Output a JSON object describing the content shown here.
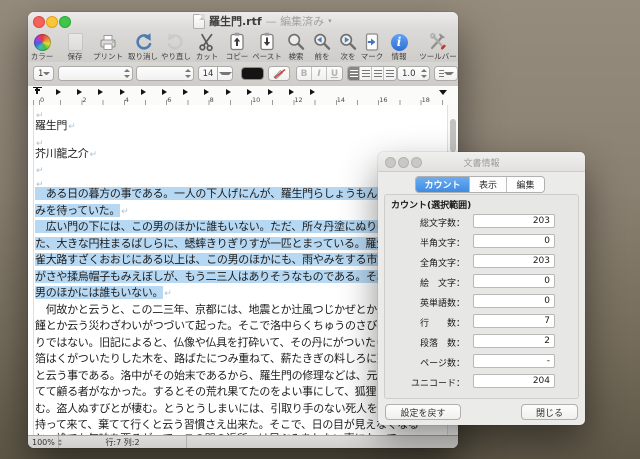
{
  "colors": {
    "accent_blue": "#4f9ce8",
    "selection_blue": "#b7d8f2",
    "tab_active": "#3f8be3"
  },
  "window": {
    "title": "羅生門.rtf",
    "title_state": "— 編集済み",
    "toolbar": {
      "items": [
        {
          "label": "カラー",
          "icon": "color-wheel"
        },
        {
          "label": "保存",
          "icon": "save-document",
          "disabled": true
        },
        {
          "label": "プリント",
          "icon": "printer"
        },
        {
          "label": "取り消し",
          "icon": "undo-arrow"
        },
        {
          "label": "やり直し",
          "icon": "redo-arrow",
          "disabled": true
        },
        {
          "label": "カット",
          "icon": "scissors"
        },
        {
          "label": "コピー",
          "icon": "copy-clipboard"
        },
        {
          "label": "ペースト",
          "icon": "paste-clipboard"
        },
        {
          "label": "検索",
          "icon": "search-magnifier"
        },
        {
          "label": "前を",
          "icon": "find-previous-magnifier"
        },
        {
          "label": "次を",
          "icon": "find-next-magnifier"
        },
        {
          "label": "マーク",
          "icon": "mark-page"
        },
        {
          "label": "情報",
          "icon": "info-circle"
        },
        {
          "label": "ツールバー",
          "icon": "toolbar-tools"
        }
      ]
    },
    "format_bar": {
      "style_value": "1",
      "font_size": "14",
      "bold": "B",
      "italic": "I",
      "underline": "U",
      "line_spacing": "1.0"
    },
    "ruler": {
      "numbers": [
        "0",
        "2",
        "4",
        "6",
        "8",
        "10",
        "12",
        "14",
        "16",
        "18"
      ]
    },
    "document": {
      "lines": [
        {
          "text": "",
          "pilcrow": true
        },
        {
          "text": "羅生門",
          "pilcrow": true
        },
        {
          "text": "",
          "pilcrow": true
        },
        {
          "text": "芥川龍之介",
          "pilcrow": true
        },
        {
          "text": "",
          "pilcrow": true
        },
        {
          "text": "",
          "pilcrow": true
        },
        {
          "text": "　ある日の暮方の事である。一人の下人げにんが、羅生門らしょうもんの下で雨や",
          "selected": true
        },
        {
          "text": "みを待っていた。",
          "selected": true,
          "pilcrow": true
        },
        {
          "text": "　広い門の下には、この男のほかに誰もいない。ただ、所々丹塗にぬりの剥げ",
          "selected": true
        },
        {
          "text": "た、大きな円柱まるばしらに、蟋蟀きりぎりすが一匹とまっている。羅生門が、朱",
          "selected": true
        },
        {
          "text": "雀大路すざくおおじにある以上は、この男のほかにも、雨やみをする市女笠いちめ",
          "selected": true
        },
        {
          "text": "がさや揉烏帽子もみえぼしが、もう二三人はありそうなものである。それが、この",
          "selected": true
        },
        {
          "text": "男のほかには誰もいない。",
          "selected": true,
          "pilcrow": true
        },
        {
          "text": "　何故かと云うと、この二三年、京都には、地震とか辻風つじかぜとか火事とか饑"
        },
        {
          "text": "饉とか云う災わざわいがつづいて起った。そこで洛中らくちゅうのさびれ方は一通"
        },
        {
          "text": "りではない。旧記によると、仏像や仏具を打砕いて、その丹にがついたり、金銀の"
        },
        {
          "text": "箔はくがついたりした木を、路ばたにつみ重ねて、薪たきぎの料しろに売っていた"
        },
        {
          "text": "と云う事である。洛中がその始末であるから、羅生門の修理などは、元より誰も捨"
        },
        {
          "text": "てて顧る者がなかった。するとその荒れ果てたのをよい事にして、狐狸こりが棲"
        },
        {
          "text": "む。盗人ぬすびとが棲む。とうとうしまいには、引取り手のない死人を、この門へ"
        },
        {
          "text": "持って来て、棄てて行くと云う習慣さえ出来た。そこで、日の目が見えなくなる"
        },
        {
          "text": "と、誰でも気味を悪るがって、この門の近所へは足ぶみをしない事になって"
        }
      ]
    },
    "status_bar": {
      "zoom": "100%",
      "position": "行:7 列:2"
    }
  },
  "panel": {
    "title": "文書情報",
    "tabs": [
      {
        "label": "カウント",
        "active": true
      },
      {
        "label": "表示",
        "active": false
      },
      {
        "label": "編集",
        "active": false
      }
    ],
    "section_label": "カウント(選択範囲)",
    "rows": [
      {
        "label": "総文字数：",
        "value": "203"
      },
      {
        "label": "半角文字：",
        "value": "0"
      },
      {
        "label": "全角文字：",
        "value": "203"
      },
      {
        "label": "絵　文字：",
        "value": "0"
      },
      {
        "label": "英単語数：",
        "value": "0"
      },
      {
        "label": "行　　数：",
        "value": "7"
      },
      {
        "label": "段落　数：",
        "value": "2"
      },
      {
        "label": "ページ数：",
        "value": "-"
      },
      {
        "label": "ユニコード：",
        "value": "204"
      }
    ],
    "buttons": {
      "reset": "設定を戻す",
      "close": "閉じる"
    }
  }
}
